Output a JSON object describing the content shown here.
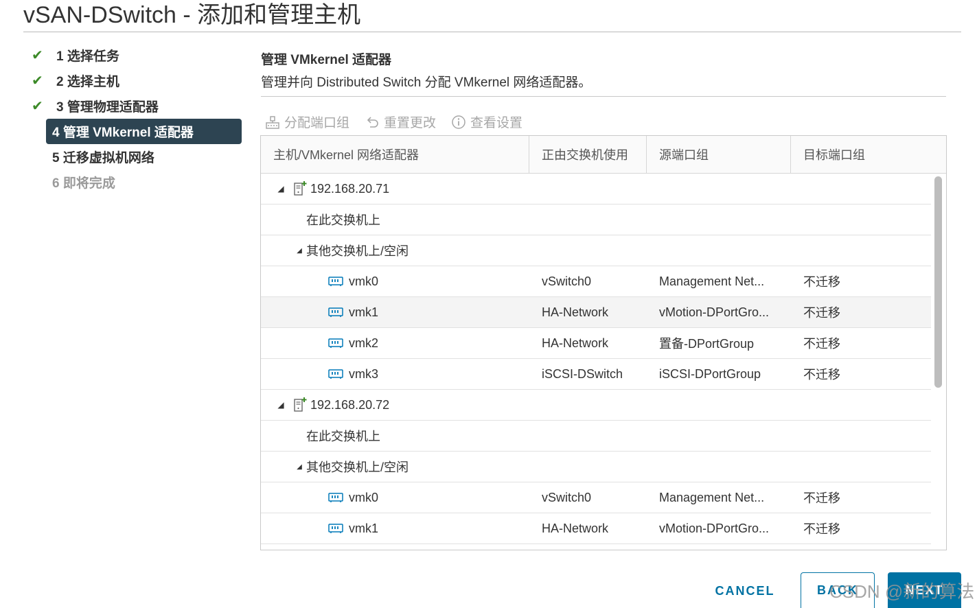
{
  "window": {
    "title": "vSAN-DSwitch - 添加和管理主机"
  },
  "steps": [
    {
      "label": "1 选择任务",
      "state": "done"
    },
    {
      "label": "2 选择主机",
      "state": "done"
    },
    {
      "label": "3 管理物理适配器",
      "state": "done"
    },
    {
      "label": "4 管理 VMkernel 适配器",
      "state": "active"
    },
    {
      "label": "5 迁移虚拟机网络",
      "state": "plain"
    },
    {
      "label": "6 即将完成",
      "state": "pending"
    }
  ],
  "main": {
    "heading": "管理 VMkernel 适配器",
    "description": "管理并向 Distributed Switch 分配 VMkernel 网络适配器。"
  },
  "toolbar": {
    "assign": {
      "label": "分配端口组",
      "icon": "assign-portgroup-icon"
    },
    "reset": {
      "label": "重置更改",
      "icon": "undo-icon"
    },
    "view": {
      "label": "查看设置",
      "icon": "info-icon"
    }
  },
  "table": {
    "headers": [
      "主机/VMkernel 网络适配器",
      "正由交换机使用",
      "源端口组",
      "目标端口组"
    ],
    "rows": [
      {
        "type": "host",
        "name": "192.168.20.71"
      },
      {
        "type": "group",
        "name": "在此交换机上"
      },
      {
        "type": "group-exp",
        "name": "其他交换机上/空闲"
      },
      {
        "type": "vmk",
        "name": "vmk0",
        "switch": "vSwitch0",
        "source": "Management Net...",
        "target": "不迁移"
      },
      {
        "type": "vmk",
        "name": "vmk1",
        "switch": "HA-Network",
        "source": "vMotion-DPortGro...",
        "target": "不迁移",
        "highlight": true
      },
      {
        "type": "vmk",
        "name": "vmk2",
        "switch": "HA-Network",
        "source": "置备-DPortGroup",
        "target": "不迁移"
      },
      {
        "type": "vmk",
        "name": "vmk3",
        "switch": "iSCSI-DSwitch",
        "source": "iSCSI-DPortGroup",
        "target": "不迁移"
      },
      {
        "type": "host",
        "name": "192.168.20.72"
      },
      {
        "type": "group",
        "name": "在此交换机上"
      },
      {
        "type": "group-exp",
        "name": "其他交换机上/空闲"
      },
      {
        "type": "vmk",
        "name": "vmk0",
        "switch": "vSwitch0",
        "source": "Management Net...",
        "target": "不迁移"
      },
      {
        "type": "vmk",
        "name": "vmk1",
        "switch": "HA-Network",
        "source": "vMotion-DPortGro...",
        "target": "不迁移"
      }
    ]
  },
  "footer": {
    "cancel": "CANCEL",
    "back": "BACK",
    "next": "NEXT"
  },
  "watermark": "CSDN @新的算法",
  "colors": {
    "accent": "#0072a3",
    "active_step_bg": "#2d4452",
    "check": "#3c8a28"
  }
}
